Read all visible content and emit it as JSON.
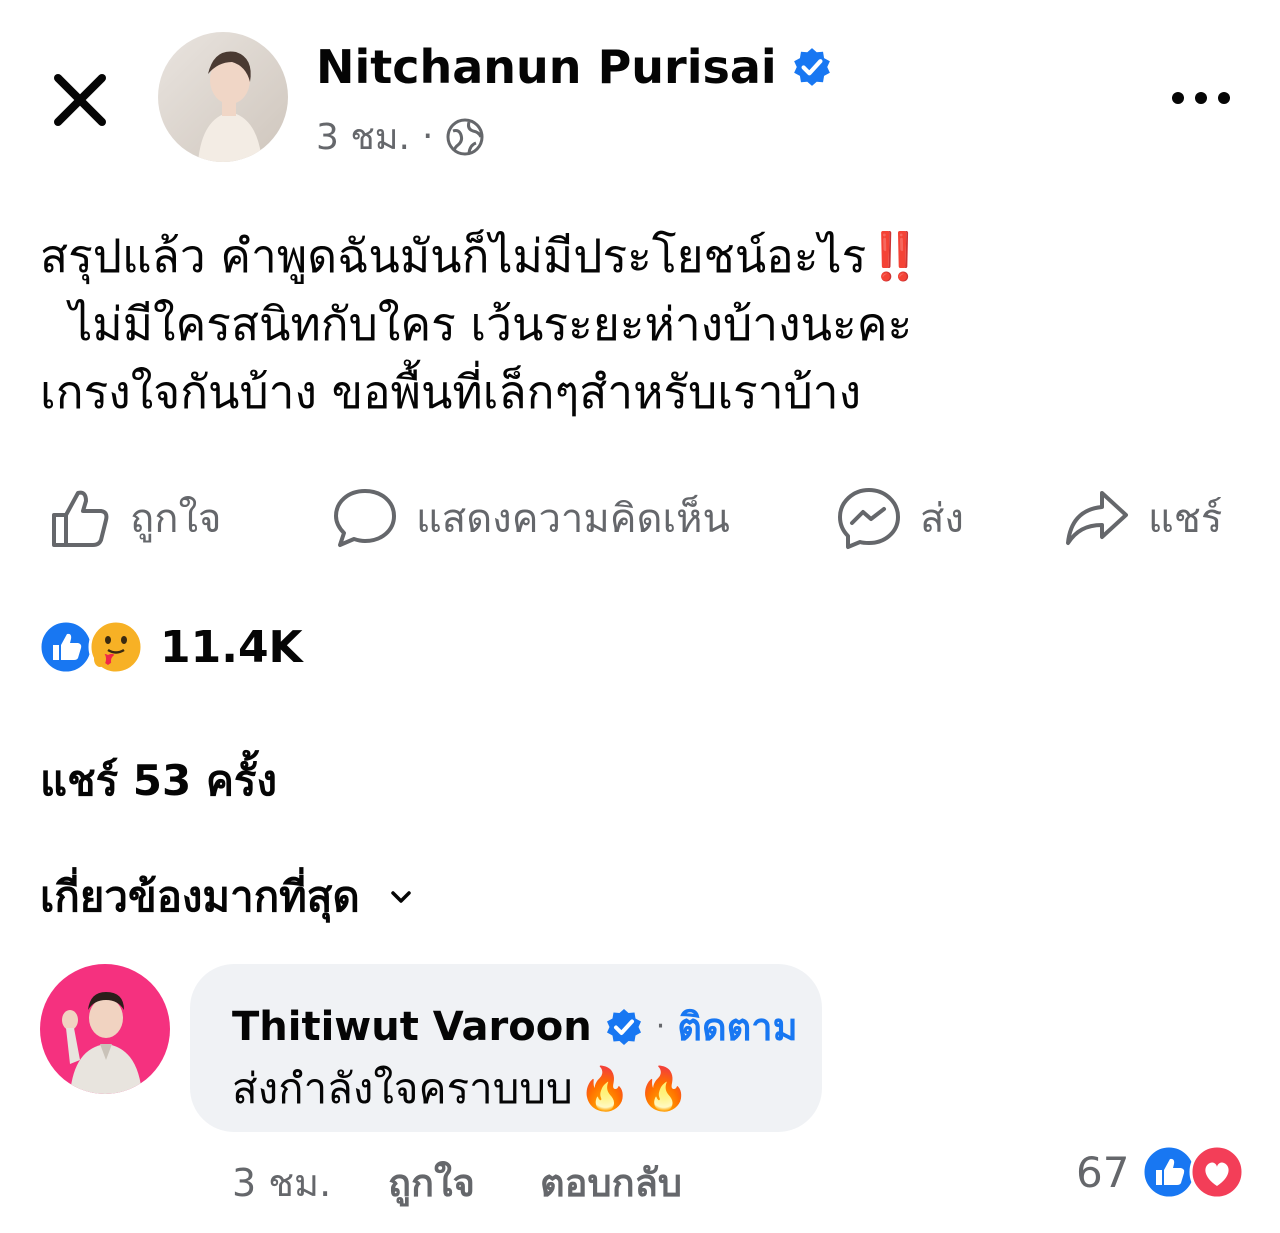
{
  "post": {
    "author": "Nitchanun Purisai",
    "time": "3 ชม.",
    "separator": "·",
    "text_lines": [
      "สรุปแล้ว คำพูดฉันมันก็ไม่มีประโยชน์อะไร",
      "  ไม่มีใครสนิทกับใคร เว้นระยะห่างบ้างนะคะ",
      "เกรงใจกันบ้าง ขอพื้นที่เล็กๆสำหรับเราบ้าง"
    ],
    "emphasis": "‼️"
  },
  "actions": {
    "like": "ถูกใจ",
    "comment": "แสดงความคิดเห็น",
    "send": "ส่ง",
    "share": "แชร์"
  },
  "reactions": {
    "count": "11.4K",
    "icons": [
      "like-icon",
      "care-icon"
    ]
  },
  "shares": "แชร์ 53 ครั้ง",
  "sort": {
    "label": "เกี่ยวข้องมากที่สุด"
  },
  "comment": {
    "author": "Thitiwut Varoon",
    "separator": "·",
    "follow": "ติดตาม",
    "text": "ส่งกำลังใจคราบบบ",
    "emoji": [
      "🔥",
      "🔥"
    ],
    "time": "3 ชม.",
    "like": "ถูกใจ",
    "reply": "ตอบกลับ",
    "reaction_count": "67",
    "reaction_icons": [
      "like-icon",
      "love-icon"
    ]
  },
  "colors": {
    "facebook_blue": "#1877f2",
    "secondary_text": "#65676b",
    "bubble_bg": "#f0f2f5",
    "love_red": "#f33e58"
  }
}
